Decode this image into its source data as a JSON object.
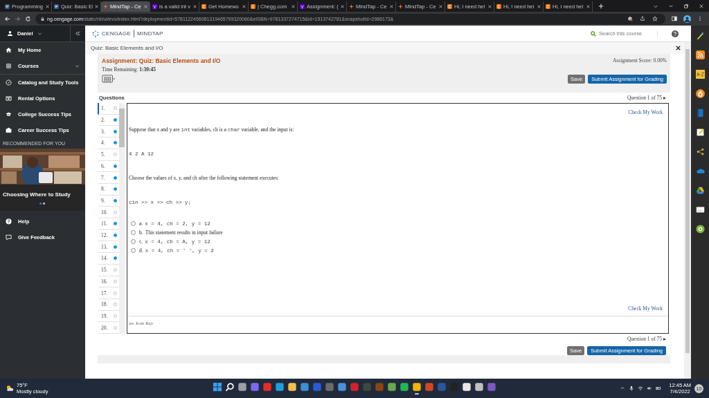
{
  "browser": {
    "tabs": [
      {
        "title": "Programming",
        "kind": "book",
        "selected": false
      },
      {
        "title": "Quiz: Basic El",
        "kind": "book",
        "selected": false
      },
      {
        "title": "MindTap - Ce",
        "kind": "star",
        "selected": true
      },
      {
        "title": "is a valid int v",
        "kind": "purple",
        "selected": false
      },
      {
        "title": "Get Homewo",
        "kind": "chegg",
        "selected": false
      },
      {
        "title": "| Chegg.com",
        "kind": "chegg",
        "selected": false
      },
      {
        "title": "Assignment: (",
        "kind": "purple",
        "selected": false
      },
      {
        "title": "MindTap - Ce",
        "kind": "star",
        "selected": false
      },
      {
        "title": "MindTap - Ce",
        "kind": "star",
        "selected": false
      },
      {
        "title": "Hi, I need hel",
        "kind": "chegg",
        "selected": false
      },
      {
        "title": "Hi, I need hel",
        "kind": "chegg",
        "selected": false
      },
      {
        "title": "Hi, I need hel",
        "kind": "chegg",
        "selected": false
      }
    ],
    "address": {
      "host": "ng.cengage.com",
      "path": "/static/nb/ui/evo/index.html?deploymentId=5781122456081319465799320060&eISBN=9781337274715&id=1513742781&snapshotId=2986173&"
    }
  },
  "sidebar": {
    "user": "Daniel",
    "items": [
      {
        "label": "My Home",
        "kind": "home",
        "submenu": false
      },
      {
        "label": "Courses",
        "kind": "courses",
        "submenu": true
      },
      {
        "label": "Catalog and Study Tools",
        "kind": "compass",
        "submenu": false
      },
      {
        "label": "Rental Options",
        "kind": "book",
        "submenu": false
      },
      {
        "label": "College Success Tips",
        "kind": "cap",
        "submenu": false
      },
      {
        "label": "Career Success Tips",
        "kind": "briefcase",
        "submenu": false
      }
    ],
    "section_heading": "RECOMMENDED FOR YOU",
    "feature": {
      "caption": "Choosing Where to Study",
      "dots": [
        {
          "selected": true
        },
        {
          "selected": false
        }
      ]
    },
    "footer_items": [
      {
        "label": "Help",
        "kind": "help"
      },
      {
        "label": "Give Feedback",
        "kind": "feedback"
      }
    ]
  },
  "header": {
    "logo_left": "CENGAGE",
    "logo_right": "MINDTAP",
    "search_placeholder": "Search this course"
  },
  "breadcrumb": "Quiz: Basic Elements and I/O",
  "assignment": {
    "title": "Assignment: Quiz: Basic Elements and I/O",
    "score": "Assignment Score: 0.00%",
    "time_label": "Time Remaining:",
    "time_value": "1:30:45",
    "save": "Save",
    "submit": "Submit Assignment for Grading",
    "questions_heading": "Questions",
    "counter": "Question 1 of 75 ▸",
    "check_top": "Check My Work",
    "check_bottom": "Check My Work",
    "icon_key": "Icon Key",
    "counter_bottom": "Question 1 of 75 ▸",
    "save_bottom": "Save",
    "submit_bottom": "Submit Assignment for Grading",
    "questions": [
      {
        "number": "1.",
        "answered": false,
        "selected": true
      },
      {
        "number": "2.",
        "answered": true,
        "selected": false
      },
      {
        "number": "3.",
        "answered": true,
        "selected": false
      },
      {
        "number": "4.",
        "answered": true,
        "selected": false
      },
      {
        "number": "5.",
        "answered": false,
        "selected": false
      },
      {
        "number": "6.",
        "answered": true,
        "selected": false
      },
      {
        "number": "7.",
        "answered": true,
        "selected": false
      },
      {
        "number": "8.",
        "answered": true,
        "selected": false
      },
      {
        "number": "9.",
        "answered": true,
        "selected": false
      },
      {
        "number": "10.",
        "answered": false,
        "selected": false
      },
      {
        "number": "11.",
        "answered": true,
        "selected": false
      },
      {
        "number": "12.",
        "answered": true,
        "selected": false
      },
      {
        "number": "13.",
        "answered": true,
        "selected": false
      },
      {
        "number": "14.",
        "answered": true,
        "selected": false
      },
      {
        "number": "15.",
        "answered": false,
        "selected": false
      },
      {
        "number": "16.",
        "answered": false,
        "selected": false
      },
      {
        "number": "17.",
        "answered": false,
        "selected": false
      },
      {
        "number": "18.",
        "answered": false,
        "selected": false
      },
      {
        "number": "19.",
        "answered": false,
        "selected": false
      },
      {
        "number": "20.",
        "answered": false,
        "selected": false
      }
    ],
    "content": [
      {
        "kind": "prose",
        "segments": [
          {
            "kind": "text",
            "text": "Suppose that x and y are "
          },
          {
            "kind": "code",
            "text": "int"
          },
          {
            "kind": "text",
            "text": " variables, ch is a "
          },
          {
            "kind": "code",
            "text": "char"
          },
          {
            "kind": "text",
            "text": " variable, and the input is:"
          }
        ]
      },
      {
        "kind": "code",
        "segments": [
          {
            "kind": "code",
            "text": "4 2 A 12"
          }
        ]
      },
      {
        "kind": "prose",
        "segments": [
          {
            "kind": "text",
            "text": "Choose the values of x, y, and ch after the following statement executes:"
          }
        ]
      },
      {
        "kind": "code",
        "segments": [
          {
            "kind": "code",
            "text": "cin >> x >> ch >> y;"
          }
        ]
      }
    ],
    "options": [
      {
        "letter": "a.",
        "text": "x = 4, ch = 2, y = 12",
        "kind": "code",
        "selected": false
      },
      {
        "letter": "b.",
        "text": "This statement results in input failure",
        "kind": "text",
        "selected": false
      },
      {
        "letter": "c.",
        "text": "x = 4, ch = A, y = 12",
        "kind": "code",
        "selected": false
      },
      {
        "letter": "d.",
        "text": "x = 4, ch = ' ', y = 2",
        "kind": "code",
        "selected": false
      }
    ]
  },
  "taskbar": {
    "temperature": "75°F",
    "weather": "Mostly cloudy",
    "apps": [
      {
        "kind": "windows",
        "color": "#3aa0f0",
        "active": false
      },
      {
        "kind": "search",
        "color": "#ffffff",
        "active": false
      },
      {
        "kind": "tile",
        "color": "#9aa0a6",
        "active": false
      },
      {
        "kind": "tile",
        "color": "#7b68ee",
        "active": false
      },
      {
        "kind": "tile",
        "color": "#e52d27",
        "active": false
      },
      {
        "kind": "tile",
        "color": "#1f9ede",
        "active": false
      },
      {
        "kind": "tile",
        "color": "#f2c14e",
        "active": false
      },
      {
        "kind": "tile",
        "color": "#3b8ed8",
        "active": false
      },
      {
        "kind": "tile",
        "color": "#2a5bd7",
        "active": false
      },
      {
        "kind": "tile",
        "color": "#6b6b6b",
        "active": false
      },
      {
        "kind": "tile",
        "color": "#4a90d9",
        "active": false
      },
      {
        "kind": "tile",
        "color": "#d6202a",
        "active": false
      },
      {
        "kind": "tile",
        "color": "#3c4a3c",
        "active": false
      },
      {
        "kind": "tile",
        "color": "#8b4513",
        "active": false
      },
      {
        "kind": "tile",
        "color": "#6aa84f",
        "active": false
      },
      {
        "kind": "tile",
        "color": "#1db954",
        "active": false
      },
      {
        "kind": "tile",
        "color": "#f4b400",
        "active": true
      },
      {
        "kind": "tile",
        "color": "#d24726",
        "active": false
      },
      {
        "kind": "tile",
        "color": "#2b579a",
        "active": false
      },
      {
        "kind": "tile",
        "color": "#222222",
        "active": false
      },
      {
        "kind": "tile",
        "color": "#e8e8e8",
        "active": false
      },
      {
        "kind": "tile",
        "color": "#c0c0c0",
        "active": false
      },
      {
        "kind": "tile",
        "color": "#7e57c2",
        "active": false
      }
    ],
    "time": "12:45 AM",
    "date": "7/4/2022",
    "badge": "10"
  }
}
